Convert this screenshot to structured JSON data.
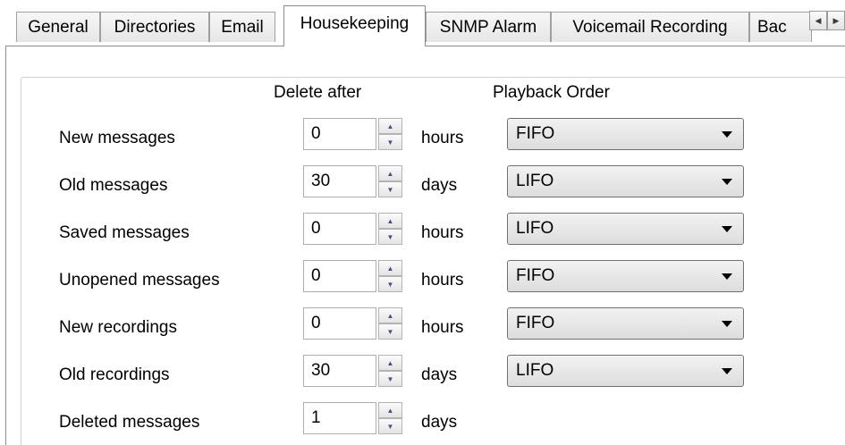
{
  "tabs": [
    {
      "label": "General"
    },
    {
      "label": "Directories"
    },
    {
      "label": "Email"
    },
    {
      "label": "Housekeeping"
    },
    {
      "label": "SNMP Alarm"
    },
    {
      "label": "Voicemail Recording"
    },
    {
      "label": "Bac"
    }
  ],
  "active_tab": "Housekeeping",
  "icons": {
    "scroll_left": "scroll-left-icon",
    "scroll_right": "scroll-right-icon",
    "spin_up": "spin-up-icon",
    "spin_down": "spin-down-icon",
    "dropdown": "chevron-down-icon"
  },
  "headers": {
    "delete_after": "Delete after",
    "playback_order": "Playback Order"
  },
  "rows": [
    {
      "label": "New messages",
      "value": "0",
      "unit": "hours",
      "order": "FIFO"
    },
    {
      "label": "Old messages",
      "value": "30",
      "unit": "days",
      "order": "LIFO"
    },
    {
      "label": "Saved messages",
      "value": "0",
      "unit": "hours",
      "order": "LIFO"
    },
    {
      "label": "Unopened messages",
      "value": "0",
      "unit": "hours",
      "order": "FIFO"
    },
    {
      "label": "New recordings",
      "value": "0",
      "unit": "hours",
      "order": "FIFO"
    },
    {
      "label": "Old recordings",
      "value": "30",
      "unit": "days",
      "order": "LIFO"
    },
    {
      "label": "Deleted messages",
      "value": "1",
      "unit": "days",
      "order": null
    }
  ],
  "colors": {
    "tab_border": "#8c8c8c",
    "group_border": "#cfcfcf",
    "spin_arrow": "#4a4a8a"
  }
}
